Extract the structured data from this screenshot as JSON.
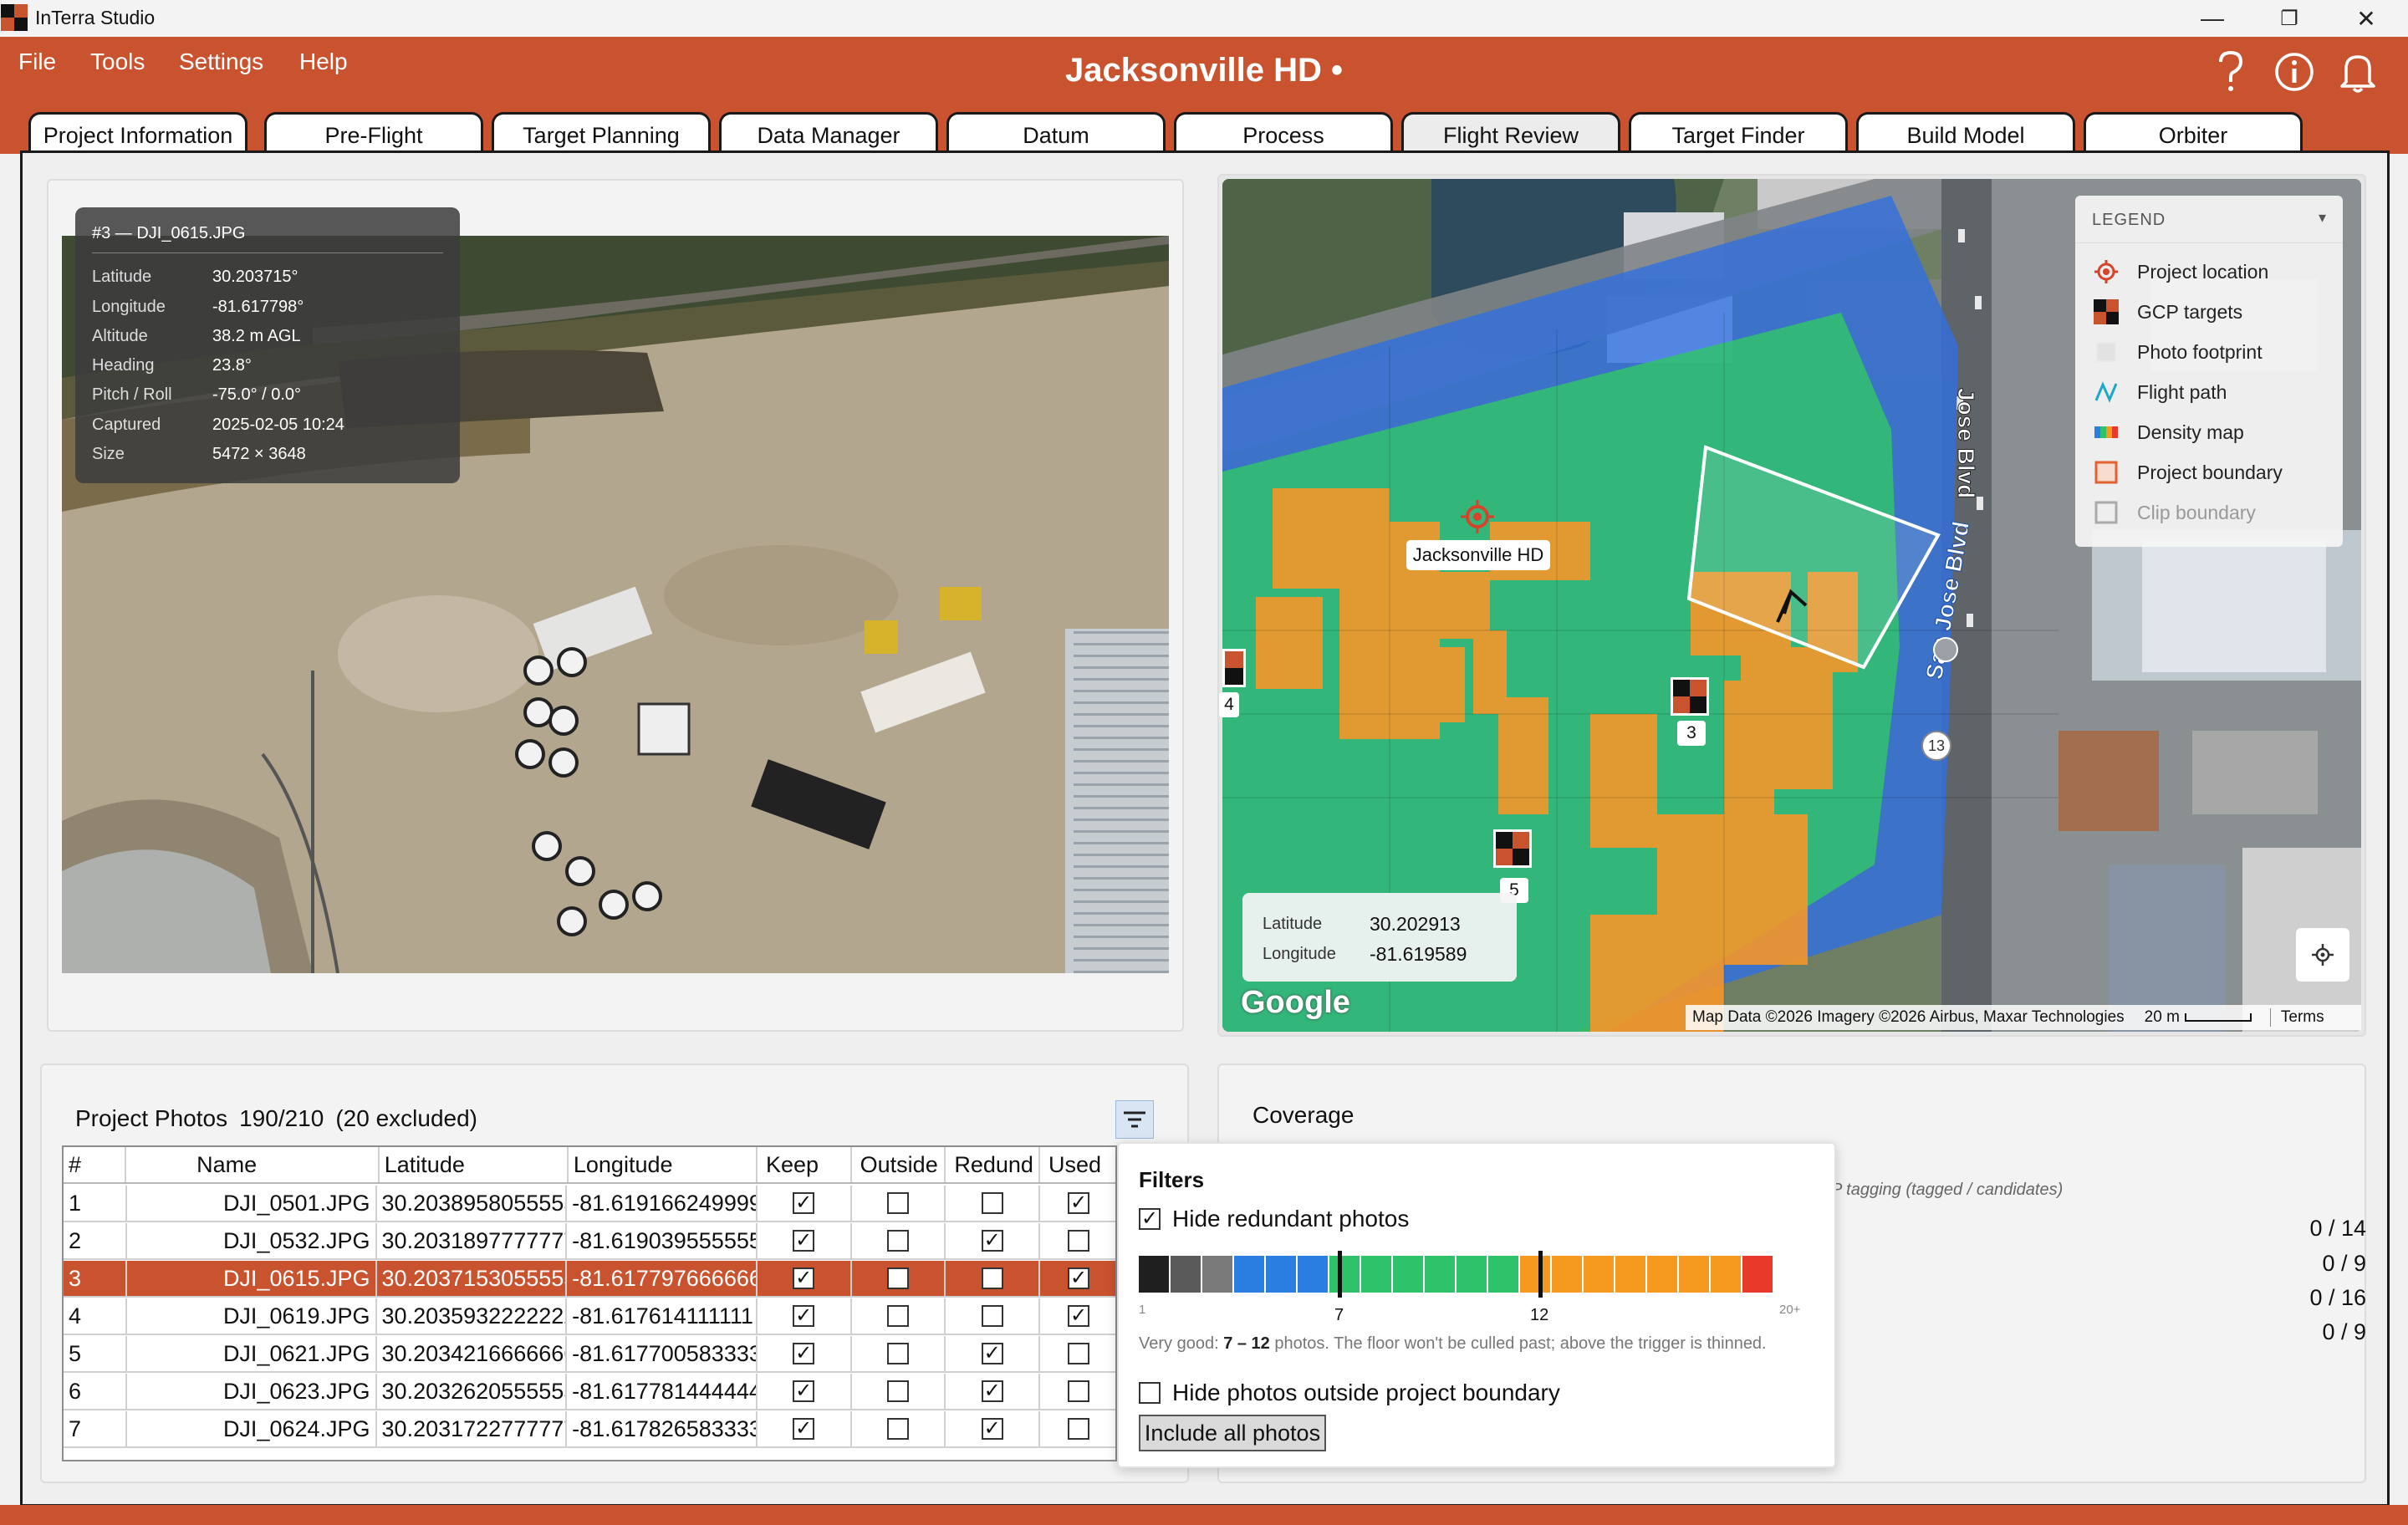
{
  "app": {
    "name": "InTerra Studio",
    "logo_colors": [
      "#c9522f",
      "#111111"
    ]
  },
  "window": {
    "minimize_glyph": "—",
    "maximize_glyph": "❐",
    "close_glyph": "✕"
  },
  "menu": {
    "items": [
      "File",
      "Tools",
      "Settings",
      "Help"
    ]
  },
  "document": {
    "title": "Jacksonville HD •"
  },
  "top_icons": [
    "help-icon",
    "info-icon",
    "bell-icon"
  ],
  "tabs": {
    "items": [
      "Project Information",
      "Pre-Flight",
      "Target Planning",
      "Data Manager",
      "Datum",
      "Process",
      "Flight Review",
      "Target Finder",
      "Build Model",
      "Orbiter"
    ],
    "active": "Flight Review"
  },
  "photo": {
    "title": "#3 — DJI_0615.JPG",
    "rows": [
      {
        "k": "Latitude",
        "v": "30.203715°"
      },
      {
        "k": "Longitude",
        "v": "-81.617798°"
      },
      {
        "k": "Altitude",
        "v": "38.2 m AGL"
      },
      {
        "k": "Heading",
        "v": "23.8°"
      },
      {
        "k": "Pitch / Roll",
        "v": "-75.0° / 0.0°"
      },
      {
        "k": "Captured",
        "v": "2025-02-05 10:24"
      },
      {
        "k": "Size",
        "v": "5472 × 3648"
      }
    ]
  },
  "map": {
    "place_label": "Jacksonville HD",
    "road_labels": [
      "Jose Blvd",
      "San Jose Blvd"
    ],
    "gcps": [
      "3",
      "4",
      "5"
    ],
    "road_shield": "13",
    "coords": {
      "lat_label": "Latitude",
      "lat": "30.202913",
      "lon_label": "Longitude",
      "lon": "-81.619589"
    },
    "google_logo": "Google",
    "attribution": "Map Data ©2026 Imagery ©2026 Airbus, Maxar Technologies",
    "scale": "20 m",
    "terms": "Terms"
  },
  "legend": {
    "title": "LEGEND",
    "caret": "▾",
    "items": [
      {
        "label": "Project location",
        "icon": "location-target-icon"
      },
      {
        "label": "GCP targets",
        "icon": "gcp-target-icon"
      },
      {
        "label": "Photo footprint",
        "icon": "footprint-icon"
      },
      {
        "label": "Flight path",
        "icon": "flight-path-icon"
      },
      {
        "label": "Density map",
        "icon": "density-icon"
      },
      {
        "label": "Project boundary",
        "icon": "boundary-icon"
      },
      {
        "label": "Clip boundary",
        "icon": "clip-icon"
      }
    ]
  },
  "photos_panel": {
    "title": "Project Photos",
    "count": "190/210",
    "excluded": "(20 excluded)",
    "columns": [
      "#",
      "Name",
      "Latitude",
      "Longitude",
      "Keep",
      "Outside",
      "Redund",
      "Used"
    ],
    "rows": [
      {
        "n": "1",
        "name": "DJI_0501.JPG",
        "lat": "30.2038958055555",
        "lon": "-81.6191662499999",
        "keep": true,
        "outside": false,
        "redund": false,
        "used": true
      },
      {
        "n": "2",
        "name": "DJI_0532.JPG",
        "lat": "30.2031897777777",
        "lon": "-81.6190395555555",
        "keep": true,
        "outside": false,
        "redund": true,
        "used": false
      },
      {
        "n": "3",
        "name": "DJI_0615.JPG",
        "lat": "30.2037153055555",
        "lon": "-81.6177976666666",
        "keep": true,
        "outside": false,
        "redund": false,
        "used": true,
        "selected": true
      },
      {
        "n": "4",
        "name": "DJI_0619.JPG",
        "lat": "30.2035932222222",
        "lon": "-81.617614111111",
        "keep": true,
        "outside": false,
        "redund": false,
        "used": true
      },
      {
        "n": "5",
        "name": "DJI_0621.JPG",
        "lat": "30.2034216666666",
        "lon": "-81.6177005833333",
        "keep": true,
        "outside": false,
        "redund": true,
        "used": false
      },
      {
        "n": "6",
        "name": "DJI_0623.JPG",
        "lat": "30.2032620555555",
        "lon": "-81.6177814444444",
        "keep": true,
        "outside": false,
        "redund": true,
        "used": false
      },
      {
        "n": "7",
        "name": "DJI_0624.JPG",
        "lat": "30.2031722777777",
        "lon": "-81.6178265833333",
        "keep": true,
        "outside": false,
        "redund": true,
        "used": false
      }
    ]
  },
  "coverage": {
    "title": "Coverage",
    "caption": "P tagging (tagged / candidates)",
    "values": [
      "0 / 14",
      "0 / 9",
      "0 / 16",
      "0 / 9"
    ]
  },
  "filters": {
    "title": "Filters",
    "hide_redundant": "Hide redundant photos",
    "hide_redundant_checked": true,
    "density_colors": [
      "#1f1f1f",
      "#5a5a5a",
      "#7a7a7a",
      "#2a7de1",
      "#2a7de1",
      "#2a7de1",
      "#2ec36a",
      "#2ec36a",
      "#2ec36a",
      "#2ec36a",
      "#2ec36a",
      "#2ec36a",
      "#f59a1f",
      "#f59a1f",
      "#f59a1f",
      "#f59a1f",
      "#f59a1f",
      "#f59a1f",
      "#f59a1f",
      "#e8392b"
    ],
    "floor": 7,
    "trigger": 12,
    "min_label": "1",
    "floor_label": "7",
    "trigger_label": "12",
    "max_label": "20+",
    "note_prefix": "Very good: ",
    "note_range": "7 – 12",
    "note_rest": " photos. The floor won't be culled past; above the trigger is thinned.",
    "hide_outside": "Hide photos outside project boundary",
    "hide_outside_checked": false,
    "include_all": "Include all photos"
  }
}
